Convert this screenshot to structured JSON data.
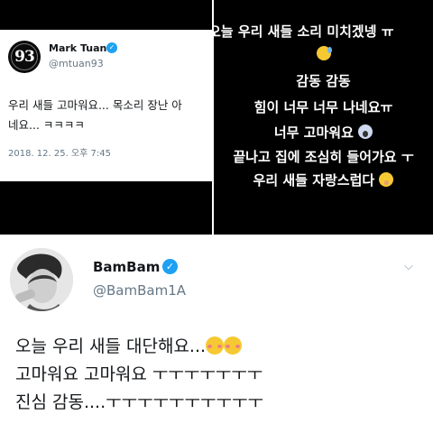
{
  "mark_tweet": {
    "name": "Mark Tuan",
    "handle": "@mtuan93",
    "avatar_text": "93",
    "text_line1": "우리 새들 고마워요... 목소리 장난 아",
    "text_line2": "네요... ㅋㅋㅋㅋ",
    "timestamp": "2018. 12. 25. 오후 7:45"
  },
  "messages": {
    "line1": "오늘 우리 새들 소리 미치겠넹 ㅠ",
    "line2": "",
    "line3": "감동 감동",
    "line4": "힘이 너무 너무 나네요ㅠ",
    "line5": "너무 고마워요",
    "line6": "끝나고 집에 조심히 들어가요 ㅜ",
    "line7": "우리 새들 자랑스럽다"
  },
  "bambam_tweet": {
    "name": "BamBam",
    "handle": "@BamBam1A",
    "text_line1": "오늘 우리 새들 대단해요...",
    "text_line2": "고마워요 고마워요 ㅜㅜㅜㅜㅜㅜㅜ",
    "text_line3": "진심 감동....ㅜㅜㅜㅜㅜㅜㅜㅜㅜㅜ"
  },
  "colors": {
    "verified": "#1da1f2",
    "secondary_text": "#657786"
  }
}
